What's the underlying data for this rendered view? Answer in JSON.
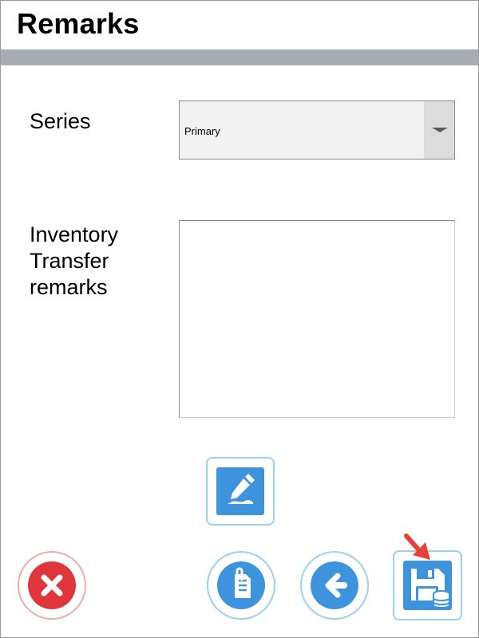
{
  "header": {
    "title": "Remarks"
  },
  "form": {
    "series_label": "Series",
    "series_value": "Primary",
    "remarks_label_line1": "Inventory",
    "remarks_label_line2": "Transfer",
    "remarks_label_line3": "remarks",
    "remarks_value": ""
  },
  "icons": {
    "sign": "pen-signature-icon",
    "cancel": "close-icon",
    "attach": "attachment-document-icon",
    "back": "arrow-left-icon",
    "save": "floppy-database-icon",
    "pointer": "red-arrow-pointer-icon"
  },
  "colors": {
    "accent_blue": "#3d93dc",
    "accent_red": "#e0353b",
    "title_bar": "#a7adb2",
    "pointer_red": "#e8413c"
  }
}
